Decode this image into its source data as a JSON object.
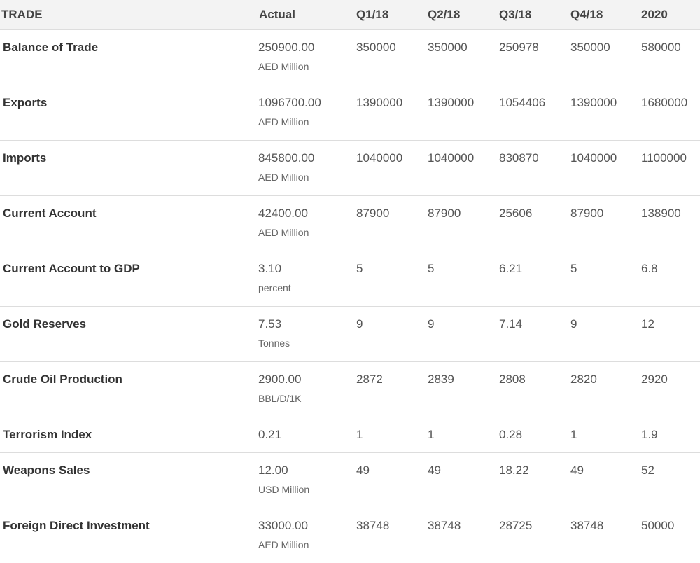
{
  "table": {
    "headers": {
      "name": "TRADE",
      "actual": "Actual",
      "q1": "Q1/18",
      "q2": "Q2/18",
      "q3": "Q3/18",
      "q4": "Q4/18",
      "year": "2020"
    },
    "rows": [
      {
        "name": "Balance of Trade",
        "actual": "250900.00",
        "unit": "AED Million",
        "q1": "350000",
        "q2": "350000",
        "q3": "250978",
        "q4": "350000",
        "year": "580000"
      },
      {
        "name": "Exports",
        "actual": "1096700.00",
        "unit": "AED Million",
        "q1": "1390000",
        "q2": "1390000",
        "q3": "1054406",
        "q4": "1390000",
        "year": "1680000"
      },
      {
        "name": "Imports",
        "actual": "845800.00",
        "unit": "AED Million",
        "q1": "1040000",
        "q2": "1040000",
        "q3": "830870",
        "q4": "1040000",
        "year": "1100000"
      },
      {
        "name": "Current Account",
        "actual": "42400.00",
        "unit": "AED Million",
        "q1": "87900",
        "q2": "87900",
        "q3": "25606",
        "q4": "87900",
        "year": "138900"
      },
      {
        "name": "Current Account to GDP",
        "actual": "3.10",
        "unit": "percent",
        "q1": "5",
        "q2": "5",
        "q3": "6.21",
        "q4": "5",
        "year": "6.8"
      },
      {
        "name": "Gold Reserves",
        "actual": "7.53",
        "unit": "Tonnes",
        "q1": "9",
        "q2": "9",
        "q3": "7.14",
        "q4": "9",
        "year": "12"
      },
      {
        "name": "Crude Oil Production",
        "actual": "2900.00",
        "unit": "BBL/D/1K",
        "q1": "2872",
        "q2": "2839",
        "q3": "2808",
        "q4": "2820",
        "year": "2920"
      },
      {
        "name": "Terrorism Index",
        "actual": "0.21",
        "unit": "",
        "q1": "1",
        "q2": "1",
        "q3": "0.28",
        "q4": "1",
        "year": "1.9"
      },
      {
        "name": "Weapons Sales",
        "actual": "12.00",
        "unit": "USD Million",
        "q1": "49",
        "q2": "49",
        "q3": "18.22",
        "q4": "49",
        "year": "52"
      },
      {
        "name": "Foreign Direct Investment",
        "actual": "33000.00",
        "unit": "AED Million",
        "q1": "38748",
        "q2": "38748",
        "q3": "28725",
        "q4": "38748",
        "year": "50000"
      }
    ]
  }
}
